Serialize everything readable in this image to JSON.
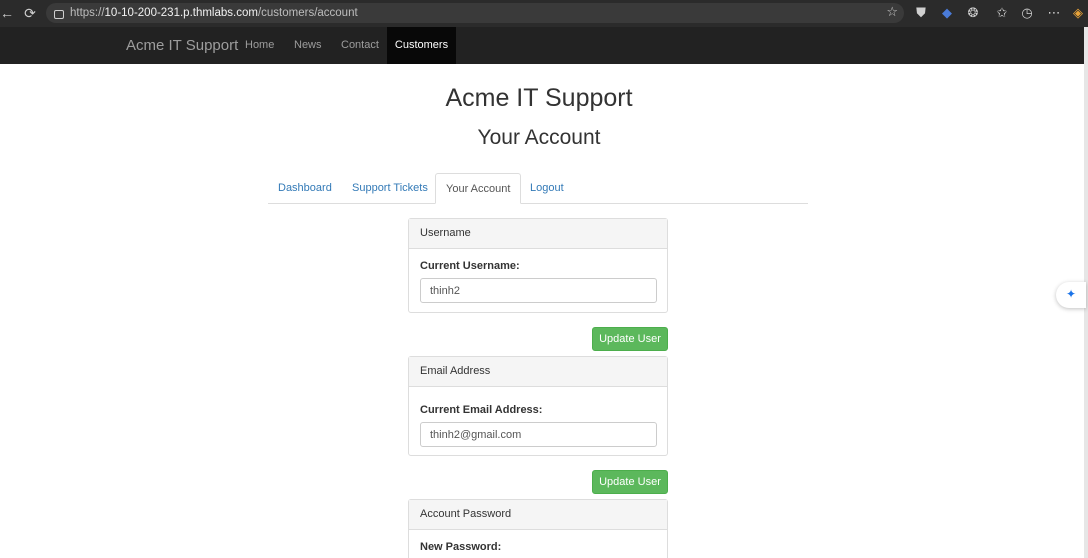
{
  "browser": {
    "url_prefix": "https://",
    "url_host": "10-10-200-231.p.thmlabs.com",
    "url_path": "/customers/account"
  },
  "site_nav": {
    "brand": "Acme IT Support",
    "links": [
      "Home",
      "News",
      "Contact"
    ],
    "active": "Customers"
  },
  "page": {
    "site_title": "Acme IT Support",
    "title": "Your Account"
  },
  "tabs": [
    "Dashboard",
    "Support Tickets",
    "Your Account",
    "Logout"
  ],
  "panels": {
    "username": {
      "heading": "Username",
      "label": "Current Username:",
      "value": "thinh2",
      "button": "Update User"
    },
    "email": {
      "heading": "Email Address",
      "label": "Current Email Address:",
      "value": "thinh2@gmail.com",
      "button": "Update User"
    },
    "password": {
      "heading": "Account Password",
      "label": "New Password:"
    }
  }
}
